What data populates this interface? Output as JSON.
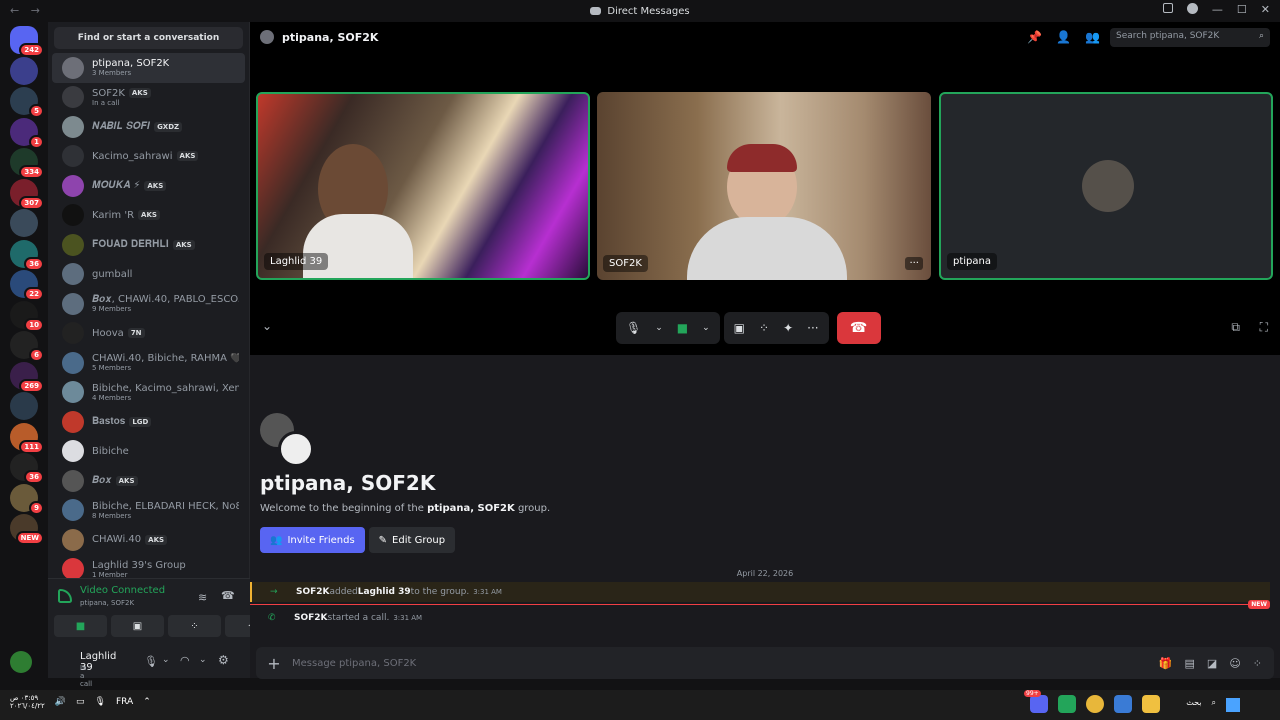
{
  "window": {
    "title": "Direct Messages",
    "back": "←",
    "forward": "→"
  },
  "servers": [
    {
      "badge": "242"
    },
    {
      "badge": ""
    },
    {
      "badge": "5"
    },
    {
      "badge": "1"
    },
    {
      "badge": "334"
    },
    {
      "badge": "307"
    },
    {
      "badge": ""
    },
    {
      "badge": "36"
    },
    {
      "badge": "22"
    },
    {
      "badge": "10"
    },
    {
      "badge": "6"
    },
    {
      "badge": "269"
    },
    {
      "badge": ""
    },
    {
      "badge": "111"
    },
    {
      "badge": "36"
    },
    {
      "badge": "9"
    },
    {
      "badge": "NEW"
    }
  ],
  "dm": {
    "search": "Find or start a conversation",
    "items": [
      {
        "name": "ptipana, SOF2K",
        "sub": "3 Members",
        "tag": "",
        "avatar": "#6d6f78",
        "active": true
      },
      {
        "name": "SOF2K",
        "sub": "In a call",
        "tag": "AKS",
        "avatar": "#3a3b40"
      },
      {
        "name": "𝑵𝑨𝑩𝑰𝑳 𝑺𝑶𝑭𝑰",
        "sub": "",
        "tag": "GXDZ",
        "avatar": "#7d8a8f"
      },
      {
        "name": "Kacimo_sahrawi",
        "sub": "",
        "tag": "AKS",
        "avatar": "#2f3136"
      },
      {
        "name": "𝑴𝑶𝑼𝑲𝑨 ⚡",
        "sub": "",
        "tag": "AKS",
        "avatar": "#8e44ad"
      },
      {
        "name": "Karim 'R",
        "sub": "",
        "tag": "AKS",
        "avatar": "#111"
      },
      {
        "name": "𝐅𝐎𝐔𝐀𝐃 𝐃𝐄𝐑𝐇𝐋𝐈",
        "sub": "",
        "tag": "AKS",
        "avatar": "#4b5320"
      },
      {
        "name": "gumball",
        "sub": "",
        "tag": "",
        "avatar": "#5d6d7e"
      },
      {
        "name": "𝑩𝒐𝒙, CHAWi.40, PABLO_ESCO...",
        "sub": "9 Members",
        "tag": "",
        "avatar": "#5d6d7e"
      },
      {
        "name": "Hoova",
        "sub": "",
        "tag": "7N",
        "avatar": "#222"
      },
      {
        "name": "CHAWi.40, Bibiche, RAHMA 🖤...",
        "sub": "5 Members",
        "tag": "",
        "avatar": "#4a6a8a"
      },
      {
        "name": "Bibiche, Kacimo_sahrawi, Xeno...",
        "sub": "4 Members",
        "tag": "",
        "avatar": "#6d8a9a"
      },
      {
        "name": "𝐁𝐚𝐬𝐭𝐨𝐬",
        "sub": "",
        "tag": "LGD",
        "avatar": "#c0392b"
      },
      {
        "name": "Bibiche",
        "sub": "",
        "tag": "",
        "avatar": "#dcdde1"
      },
      {
        "name": "𝑩𝒐𝒙",
        "sub": "",
        "tag": "AKS",
        "avatar": "#555"
      },
      {
        "name": "Bibiche, ELBADARI HECK, No8...",
        "sub": "8 Members",
        "tag": "",
        "avatar": "#4a6a8a"
      },
      {
        "name": "CHAWi.40",
        "sub": "",
        "tag": "AKS",
        "avatar": "#8b6b4a"
      },
      {
        "name": "Laghlid 39's Group",
        "sub": "1 Member",
        "tag": "",
        "avatar": "#da373c"
      }
    ]
  },
  "voice": {
    "title": "Video Connected",
    "sub": "ptipana, SOF2K"
  },
  "user": {
    "name": "Laghlid 39",
    "status": "In a call"
  },
  "header": {
    "title": "ptipana, SOF2K",
    "search_placeholder": "Search ptipana, SOF2K"
  },
  "tiles": [
    {
      "label": "Laghlid 39"
    },
    {
      "label": "SOF2K"
    },
    {
      "label": "ptipana"
    }
  ],
  "welcome": {
    "title": "ptipana, SOF2K",
    "desc_prefix": "Welcome to the beginning of the ",
    "desc_bold": "ptipana, SOF2K",
    "desc_suffix": " group.",
    "invite": "Invite Friends",
    "edit": "Edit Group"
  },
  "date_divider": "April 22, 2026",
  "messages": [
    {
      "actor": "SOF2K",
      "action": " added ",
      "target": "Laghlid 39",
      "rest": " to the group.",
      "time": "3:31 AM"
    },
    {
      "actor": "SOF2K",
      "action": " started a call.",
      "target": "",
      "rest": "",
      "time": "3:31 AM"
    }
  ],
  "new_label": "NEW",
  "composer": {
    "placeholder": "Message ptipana, SOF2K"
  },
  "taskbar": {
    "time": "٠٣:٥٩ ص",
    "date": "٢٠٢٦/٠٤/٢٢",
    "lang": "FRA",
    "search": "بحث",
    "discord_badge": "99+"
  },
  "colors": {
    "accent": "#5865f2",
    "green": "#23a55a",
    "red": "#da373c"
  }
}
